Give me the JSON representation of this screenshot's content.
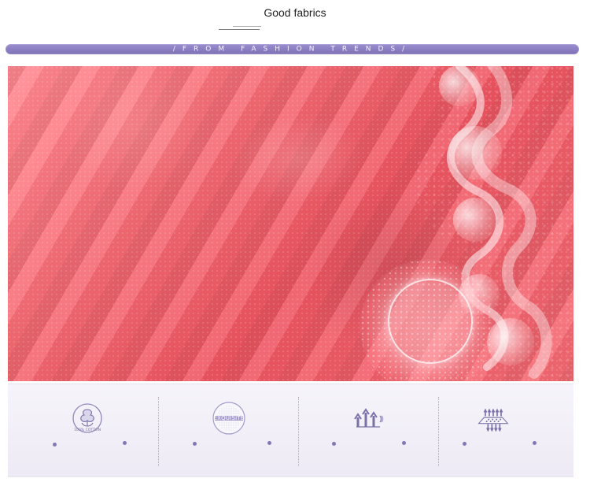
{
  "header": {
    "title": "Good fabrics"
  },
  "banner": {
    "text": "/FROM FASHION TRENDS/"
  },
  "features": {
    "badges": [
      {
        "icon": "cotton-flower-icon",
        "label": "100% COTTON"
      },
      {
        "icon": "exquisite-badge-icon",
        "label": "EXQUISITE"
      },
      {
        "icon": "breathable-arrows-icon",
        "label": ""
      },
      {
        "icon": "ventilation-mat-icon",
        "label": ""
      }
    ]
  },
  "colors": {
    "accent_purple": "#8f82c0",
    "fabric_pink": "#f06b74",
    "panel": "#f1eef6"
  }
}
